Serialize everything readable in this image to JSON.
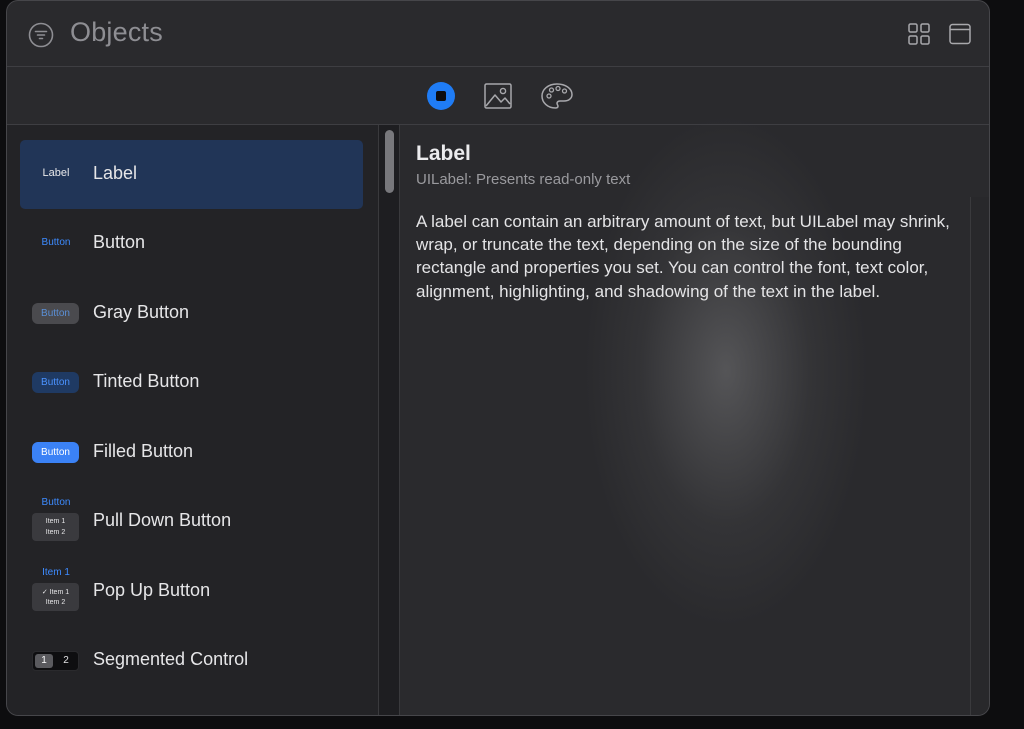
{
  "header": {
    "title": "Objects"
  },
  "toolbar": {
    "tabs": [
      {
        "name": "objects-library",
        "selected": true
      },
      {
        "name": "media-library",
        "selected": false
      },
      {
        "name": "color-library",
        "selected": false
      }
    ]
  },
  "colors": {
    "accent": "#3b82f6",
    "selected_row": "#213557",
    "window_bg": "#2a2a2d"
  },
  "library": {
    "items": [
      {
        "label": "Label",
        "thumb_text": "Label",
        "selected": true
      },
      {
        "label": "Button",
        "thumb_text": "Button"
      },
      {
        "label": "Gray Button",
        "thumb_text": "Button"
      },
      {
        "label": "Tinted Button",
        "thumb_text": "Button"
      },
      {
        "label": "Filled Button",
        "thumb_text": "Button"
      },
      {
        "label": "Pull Down Button",
        "thumb_text": "Button",
        "thumb_items": [
          "Item 1",
          "Item 2"
        ]
      },
      {
        "label": "Pop Up Button",
        "thumb_text": "Item 1",
        "thumb_items": [
          "✓ Item 1",
          "Item 2"
        ]
      },
      {
        "label": "Segmented Control",
        "thumb_segments": [
          "1",
          "2"
        ]
      }
    ]
  },
  "detail": {
    "title": "Label",
    "subtitle": "UILabel: Presents read-only text",
    "description": "A label can contain an arbitrary amount of text, but UILabel may shrink, wrap, or truncate the text, depending on the size of the bounding rectangle and properties you set. You can control the font, text color, alignment, highlighting, and shadowing of the text in the label."
  }
}
